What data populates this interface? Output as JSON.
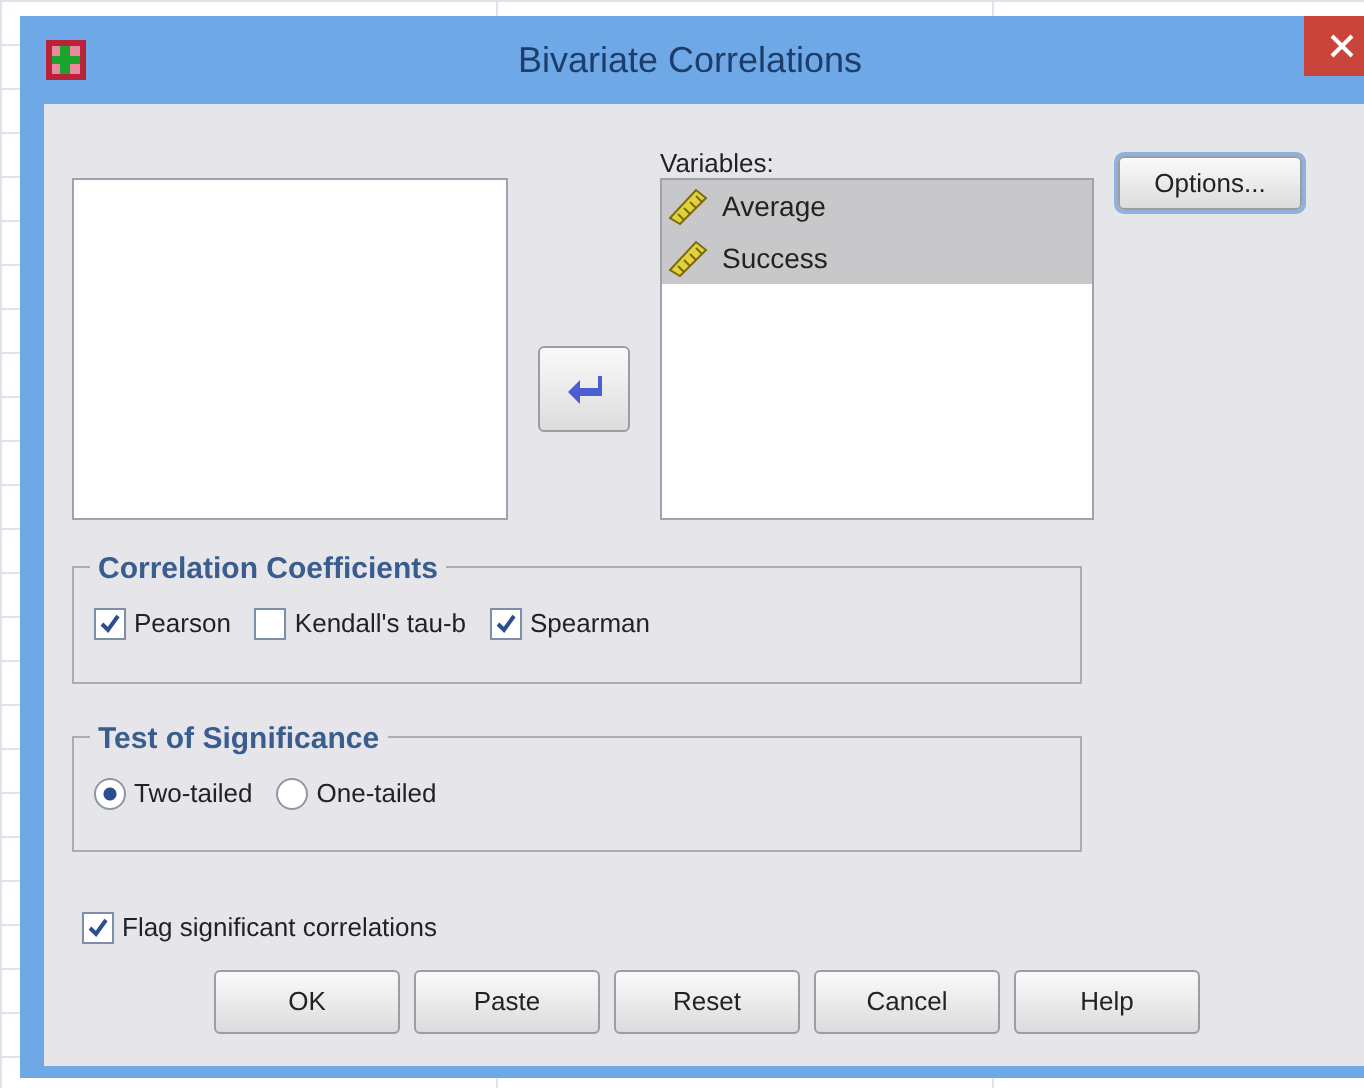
{
  "window": {
    "title": "Bivariate Correlations"
  },
  "variables": {
    "label": "Variables:",
    "items": [
      {
        "name": "Average",
        "selected": true
      },
      {
        "name": "Success",
        "selected": true
      }
    ]
  },
  "options_button": "Options...",
  "correlation_coefficients": {
    "title": "Correlation Coefficients",
    "options": [
      {
        "label": "Pearson",
        "checked": true
      },
      {
        "label": "Kendall's tau-b",
        "checked": false
      },
      {
        "label": "Spearman",
        "checked": true
      }
    ]
  },
  "test_of_significance": {
    "title": "Test of Significance",
    "options": [
      {
        "label": "Two-tailed",
        "selected": true
      },
      {
        "label": "One-tailed",
        "selected": false
      }
    ]
  },
  "flag_significant": {
    "label": "Flag significant correlations",
    "checked": true
  },
  "buttons": [
    "OK",
    "Paste",
    "Reset",
    "Cancel",
    "Help"
  ]
}
